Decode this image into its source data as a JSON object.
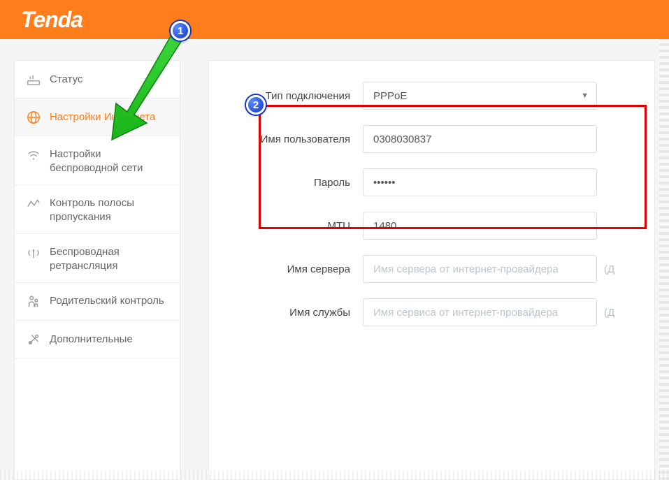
{
  "brand": "Tenda",
  "callouts": {
    "one": "1",
    "two": "2"
  },
  "sidebar": {
    "items": [
      {
        "label": "Статус"
      },
      {
        "label": "Настройки Интернета"
      },
      {
        "label": "Настройки беспроводной сети"
      },
      {
        "label": "Контроль полосы пропускания"
      },
      {
        "label": "Беспроводная ретрансляция"
      },
      {
        "label": "Родительский контроль"
      },
      {
        "label": "Дополнительные"
      }
    ]
  },
  "form": {
    "connection_type": {
      "label": "Тип подключения",
      "value": "PPPoE"
    },
    "username": {
      "label": "Имя пользователя",
      "value": "0308030837"
    },
    "password": {
      "label": "Пароль",
      "value": "••••••"
    },
    "mtu": {
      "label": "MTU",
      "value": "1480"
    },
    "server_name": {
      "label": "Имя сервера",
      "value": "",
      "placeholder": "Имя сервера от интернет-провайдера",
      "hint": "(Д"
    },
    "service_name": {
      "label": "Имя службы",
      "value": "",
      "placeholder": "Имя сервиса от интернет-провайдера",
      "hint": "(Д"
    }
  }
}
